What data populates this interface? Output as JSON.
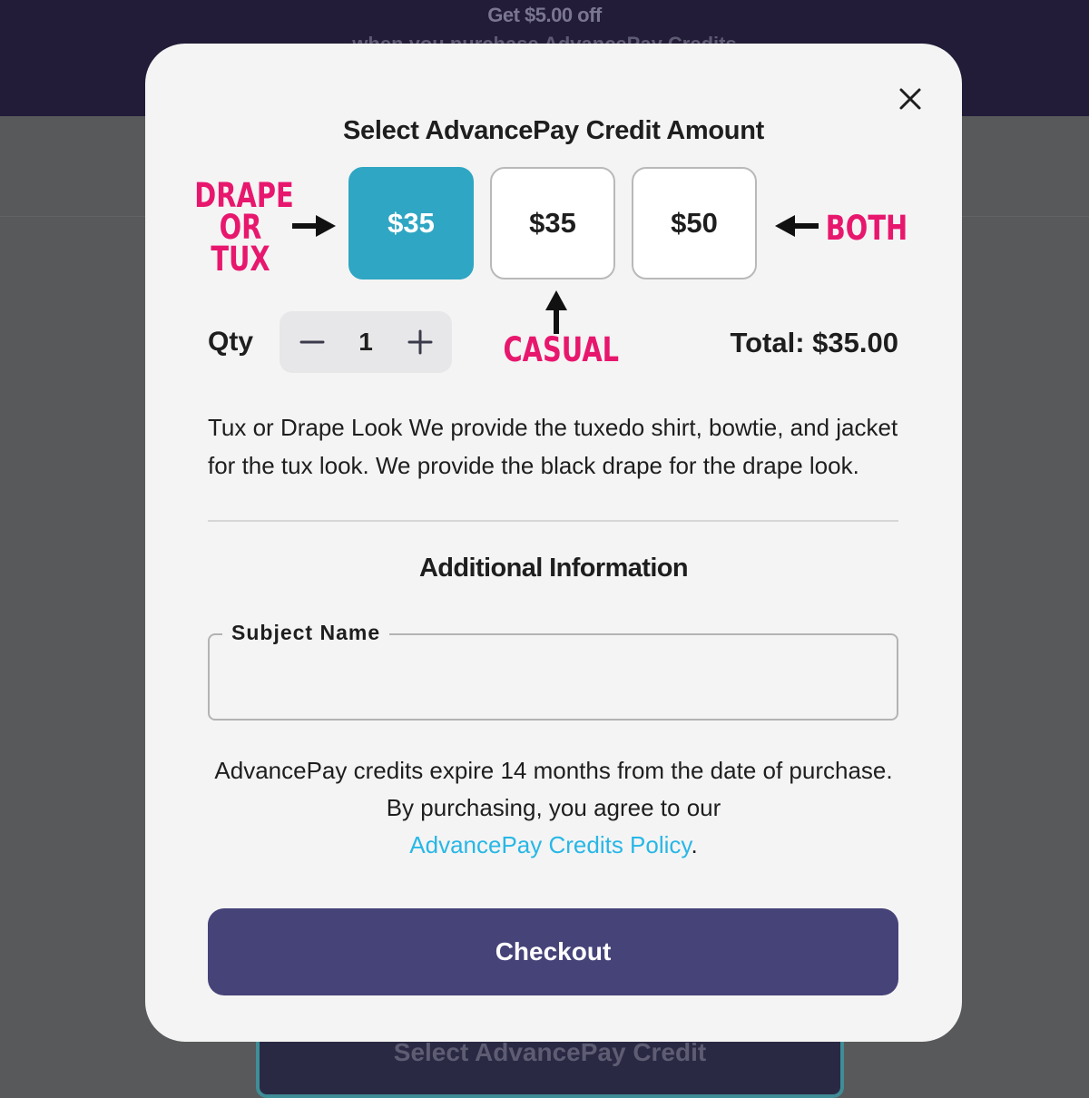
{
  "background": {
    "promo_title": "Get $5.00 off",
    "promo_sub": "when you purchase AdvancePay Credits",
    "button_label": "Select AdvancePay Credit"
  },
  "modal": {
    "title": "Select AdvancePay Credit Amount",
    "close_icon": "close-icon",
    "options": [
      {
        "label": "$35",
        "selected": true
      },
      {
        "label": "$35",
        "selected": false
      },
      {
        "label": "$50",
        "selected": false
      }
    ],
    "annotations": {
      "drape_or_tux": [
        "DRAPE",
        "OR",
        "TUX"
      ],
      "both": "BOTH",
      "casual": "CASUAL"
    },
    "qty": {
      "label": "Qty",
      "value": "1",
      "minus_icon": "minus-icon",
      "plus_icon": "plus-icon"
    },
    "total": "Total: $35.00",
    "description": "Tux or Drape Look We provide the tuxedo shirt, bowtie, and jacket for the tux look. We provide the black drape for the drape look.",
    "additional_title": "Additional Information",
    "subject_field": {
      "label": "Subject Name",
      "value": ""
    },
    "policy_text": "AdvancePay credits expire 14 months from the date of purchase. By purchasing, you agree to our",
    "policy_link": "AdvancePay Credits Policy",
    "policy_end": ".",
    "checkout_label": "Checkout"
  },
  "colors": {
    "selected_option": "#2fa6c3",
    "checkout": "#464379",
    "annotation": "#e8176e",
    "link": "#28b7e6"
  }
}
